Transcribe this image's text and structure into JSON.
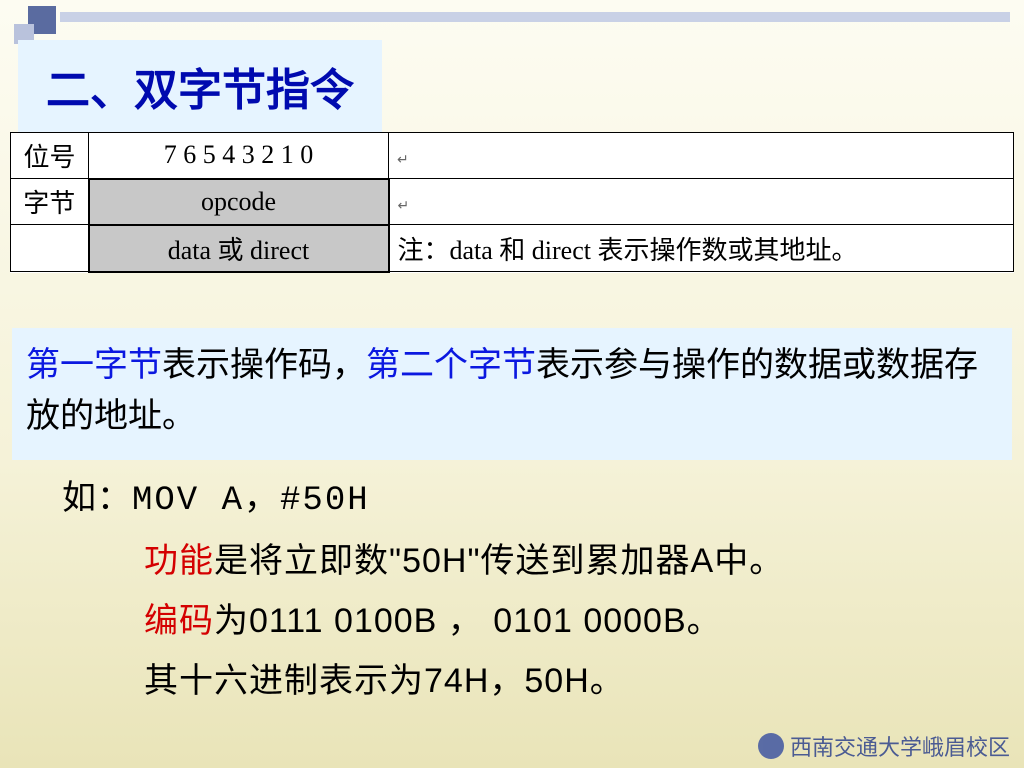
{
  "heading": "二、双字节指令",
  "table": {
    "rows": [
      {
        "label": "位号",
        "col2": "7 6 5 4 3 2 1 0",
        "col3": ""
      },
      {
        "label": "字节",
        "col2": "opcode",
        "col3": ""
      },
      {
        "label": "",
        "col2": "data 或 direct",
        "col3": "注：data 和 direct 表示操作数或其地址。"
      }
    ]
  },
  "explain": {
    "p1a": "第一字节",
    "p1b": "表示操作码，",
    "p1c": "第二个字节",
    "p1d": "表示参与操作的数据或数据存放的地址。"
  },
  "body": {
    "line1a": "如：",
    "line1b": "MOV  A，#50H",
    "line2a": "功能",
    "line2b": "是将立即数\"50H\"传送到累加器A中。",
    "line3a": "编码",
    "line3b": "为0111 0100B ， 0101 0000B。",
    "line4": "其十六进制表示为74H，50H。"
  },
  "footer": "西南交通大学峨眉校区"
}
